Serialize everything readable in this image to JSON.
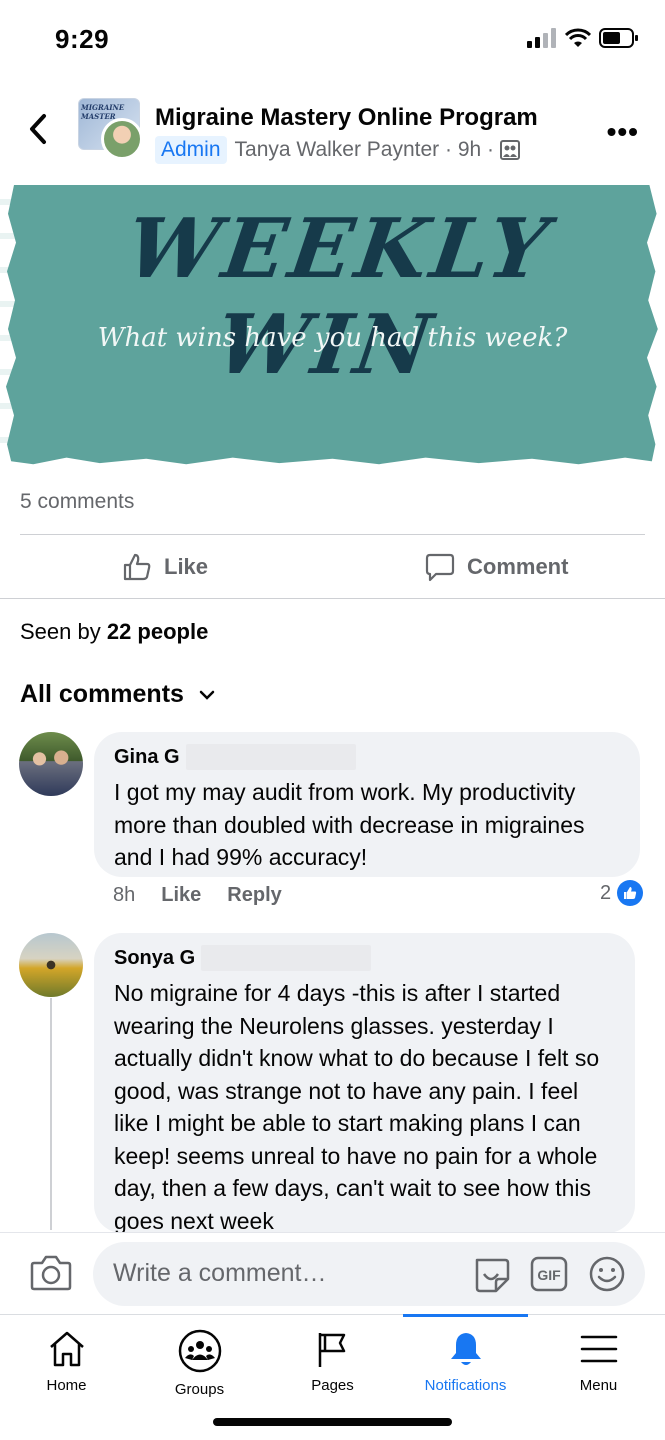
{
  "status_bar": {
    "time": "9:29"
  },
  "header": {
    "group_title": "Migraine Mastery Online Program",
    "badge": "Admin",
    "author": "Tanya Walker Paynter",
    "time": "9h",
    "group_avatar_text": "MIGRAINE MASTER"
  },
  "banner": {
    "headline": "WEEKLY WIN",
    "subline": "What wins have you had this week?"
  },
  "post_stats": {
    "comments": "5 comments"
  },
  "actions": {
    "like": "Like",
    "comment": "Comment"
  },
  "seen": {
    "prefix": "Seen by ",
    "count": "22 people"
  },
  "comments_header": "All comments",
  "comments": [
    {
      "name": "Gina G",
      "text": "I got my may audit from work. My productivity more than doubled with decrease in migraines and I had 99% accuracy!",
      "time": "8h",
      "like": "Like",
      "reply": "Reply",
      "reactions": "2"
    },
    {
      "name": "Sonya G",
      "text": "No migraine for 4 days -this is after I started wearing the Neurolens glasses.  yesterday I actually didn't know what to do because I felt so good, was strange not to have any pain.  I feel like I might be able to start making plans I can keep!  seems unreal to have no pain for a whole day, then a few days, can't wait to see how this goes next week"
    }
  ],
  "composer": {
    "placeholder": "Write a comment…"
  },
  "tabs": [
    {
      "label": "Home",
      "icon": "home-icon"
    },
    {
      "label": "Groups",
      "icon": "groups-icon"
    },
    {
      "label": "Pages",
      "icon": "flag-icon"
    },
    {
      "label": "Notifications",
      "icon": "bell-icon",
      "active": true
    },
    {
      "label": "Menu",
      "icon": "menu-icon"
    }
  ],
  "colors": {
    "accent": "#1877f2",
    "banner_bg": "#5ea39c",
    "bubble_bg": "#f0f2f5",
    "muted": "#65676b"
  }
}
